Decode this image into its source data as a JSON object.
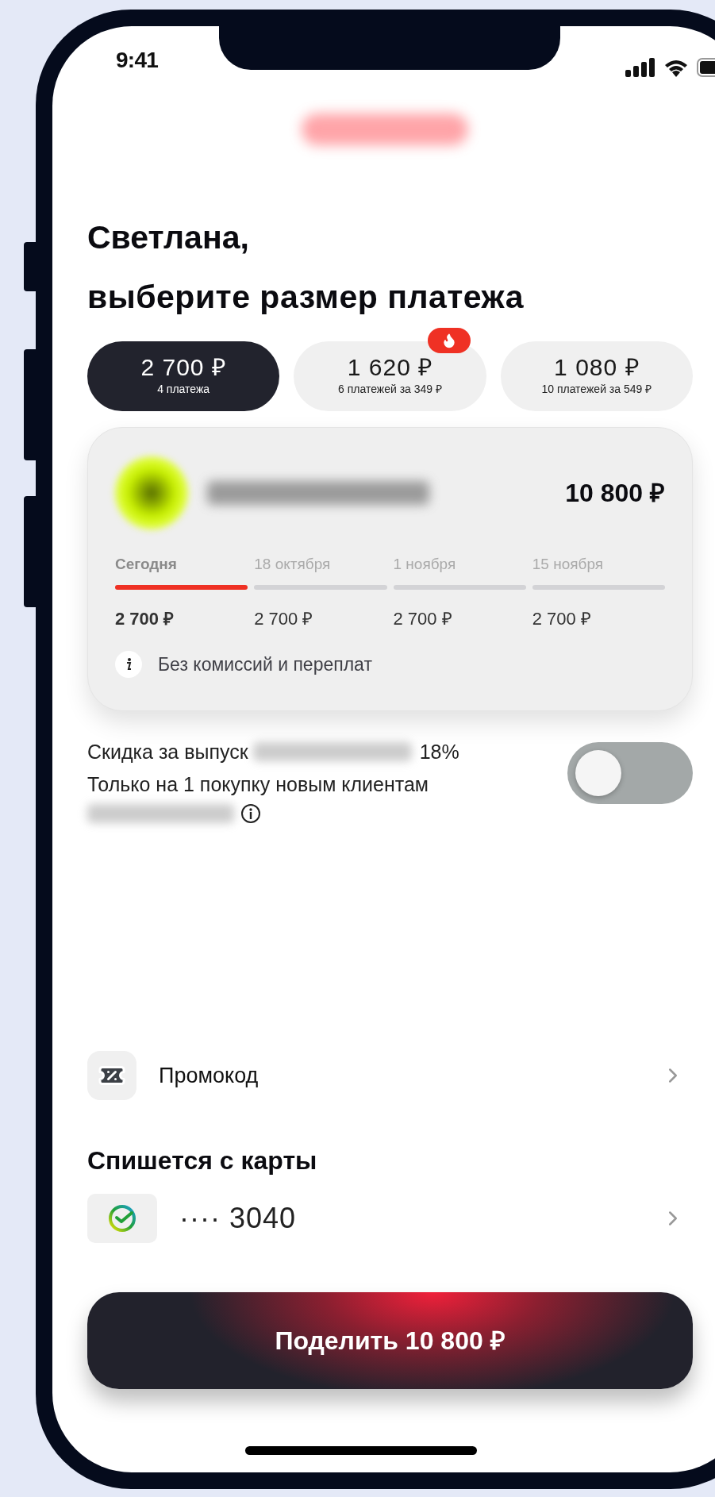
{
  "status_bar": {
    "time": "9:41"
  },
  "heading": {
    "line1": "Светлана,",
    "line2": "выберите размер платежа"
  },
  "plans": [
    {
      "amount": "2 700 ₽",
      "note": "4 платежа",
      "selected": true,
      "hot": false
    },
    {
      "amount": "1 620 ₽",
      "note": "6 платежей за 349 ₽",
      "selected": false,
      "hot": true
    },
    {
      "amount": "1 080 ₽",
      "note": "10 платежей за 549 ₽",
      "selected": false,
      "hot": false
    }
  ],
  "summary": {
    "total": "10 800 ₽",
    "schedule": [
      {
        "date": "Сегодня",
        "amount": "2 700 ₽",
        "current": true
      },
      {
        "date": "18 октября",
        "amount": "2 700 ₽",
        "current": false
      },
      {
        "date": "1 ноября",
        "amount": "2 700 ₽",
        "current": false
      },
      {
        "date": "15 ноября",
        "amount": "2 700 ₽",
        "current": false
      }
    ],
    "info": "Без комиссий и переплат"
  },
  "discount": {
    "line1": "Скидка за выпуск",
    "value": "18%",
    "line2": "Только на 1 покупку новым клиентам",
    "on": false
  },
  "promo": {
    "label": "Промокод"
  },
  "payment": {
    "title": "Спишется с карты",
    "card": "···· 3040"
  },
  "submit": {
    "label": "Поделить 10 800 ₽"
  }
}
